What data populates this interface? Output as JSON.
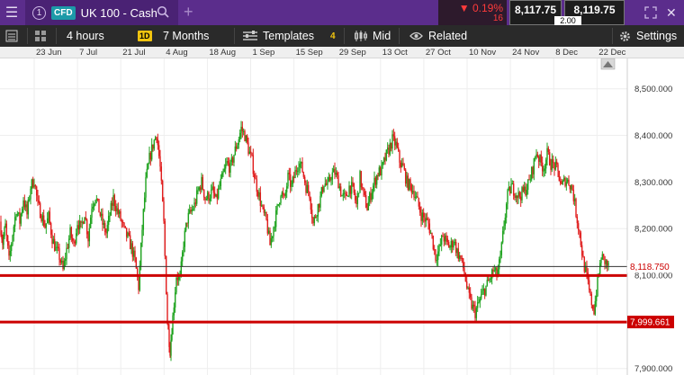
{
  "topbar": {
    "tab_number": "1",
    "instrument_type": "CFD",
    "instrument_name": "UK 100 - Cash",
    "change_percent": "▼ 0.19%",
    "change_points": "16",
    "sell_price": "8,117.75",
    "buy_price": "8,119.75",
    "spread": "2.00"
  },
  "toolbar": {
    "interval": "4 hours",
    "candle_badge": "1D",
    "range": "7 Months",
    "templates_label": "Templates",
    "templates_count": "4",
    "price_type": "Mid",
    "related_label": "Related",
    "settings_label": "Settings"
  },
  "colors": {
    "up": "#1fa31f",
    "down": "#e01d1d",
    "line": "#cc0000",
    "accent": "#5b2d8c"
  },
  "chart_data": {
    "type": "candlestick",
    "x_labels": [
      "23 Jun",
      "7 Jul",
      "21 Jul",
      "4 Aug",
      "18 Aug",
      "1 Sep",
      "15 Sep",
      "29 Sep",
      "13 Oct",
      "27 Oct",
      "10 Nov",
      "24 Nov",
      "8 Dec",
      "22 Dec"
    ],
    "y_ticks": [
      7900,
      8000,
      8100,
      8200,
      8300,
      8400,
      8500
    ],
    "y_tick_labels": [
      "7,900.000",
      "8,000.000",
      "8,100.000",
      "8,200.000",
      "8,300.000",
      "8,400.000",
      "8,500.000"
    ],
    "ylim": [
      7886,
      8565
    ],
    "current_price": 8118.75,
    "current_price_label": "8,118.750",
    "horizontal_lines": [
      {
        "value": 8099.5,
        "label": ""
      },
      {
        "value": 7999.661,
        "label": "7,999.661"
      }
    ],
    "series_path": [
      [
        0,
        8215
      ],
      [
        3,
        8170
      ],
      [
        6,
        8205
      ],
      [
        10,
        8130
      ],
      [
        14,
        8190
      ],
      [
        18,
        8240
      ],
      [
        22,
        8215
      ],
      [
        26,
        8265
      ],
      [
        30,
        8230
      ],
      [
        34,
        8290
      ],
      [
        38,
        8305
      ],
      [
        42,
        8250
      ],
      [
        46,
        8230
      ],
      [
        50,
        8205
      ],
      [
        54,
        8225
      ],
      [
        58,
        8180
      ],
      [
        62,
        8155
      ],
      [
        66,
        8140
      ],
      [
        70,
        8110
      ],
      [
        74,
        8155
      ],
      [
        78,
        8190
      ],
      [
        82,
        8165
      ],
      [
        86,
        8215
      ],
      [
        90,
        8200
      ],
      [
        94,
        8235
      ],
      [
        98,
        8180
      ],
      [
        102,
        8250
      ],
      [
        106,
        8270
      ],
      [
        110,
        8240
      ],
      [
        114,
        8210
      ],
      [
        118,
        8190
      ],
      [
        122,
        8230
      ],
      [
        126,
        8265
      ],
      [
        130,
        8240
      ],
      [
        134,
        8220
      ],
      [
        138,
        8195
      ],
      [
        142,
        8180
      ],
      [
        146,
        8160
      ],
      [
        150,
        8130
      ],
      [
        154,
        8075
      ],
      [
        158,
        8200
      ],
      [
        162,
        8300
      ],
      [
        166,
        8350
      ],
      [
        170,
        8380
      ],
      [
        174,
        8405
      ],
      [
        178,
        8330
      ],
      [
        182,
        8210
      ],
      [
        186,
        8000
      ],
      [
        189,
        7940
      ],
      [
        192,
        8010
      ],
      [
        196,
        8100
      ],
      [
        200,
        8090
      ],
      [
        204,
        8170
      ],
      [
        208,
        8220
      ],
      [
        212,
        8235
      ],
      [
        216,
        8250
      ],
      [
        220,
        8280
      ],
      [
        224,
        8300
      ],
      [
        228,
        8265
      ],
      [
        232,
        8270
      ],
      [
        236,
        8280
      ],
      [
        240,
        8260
      ],
      [
        244,
        8290
      ],
      [
        248,
        8315
      ],
      [
        252,
        8340
      ],
      [
        256,
        8330
      ],
      [
        260,
        8360
      ],
      [
        264,
        8385
      ],
      [
        268,
        8415
      ],
      [
        272,
        8400
      ],
      [
        276,
        8370
      ],
      [
        280,
        8345
      ],
      [
        284,
        8300
      ],
      [
        288,
        8270
      ],
      [
        292,
        8235
      ],
      [
        296,
        8215
      ],
      [
        300,
        8165
      ],
      [
        304,
        8205
      ],
      [
        308,
        8240
      ],
      [
        312,
        8280
      ],
      [
        316,
        8260
      ],
      [
        320,
        8310
      ],
      [
        324,
        8290
      ],
      [
        328,
        8320
      ],
      [
        332,
        8345
      ],
      [
        336,
        8325
      ],
      [
        340,
        8290
      ],
      [
        344,
        8275
      ],
      [
        348,
        8210
      ],
      [
        352,
        8240
      ],
      [
        356,
        8265
      ],
      [
        360,
        8300
      ],
      [
        364,
        8290
      ],
      [
        368,
        8315
      ],
      [
        372,
        8320
      ],
      [
        376,
        8300
      ],
      [
        380,
        8270
      ],
      [
        384,
        8265
      ],
      [
        388,
        8290
      ],
      [
        392,
        8285
      ],
      [
        396,
        8250
      ],
      [
        400,
        8310
      ],
      [
        404,
        8270
      ],
      [
        408,
        8245
      ],
      [
        412,
        8275
      ],
      [
        416,
        8300
      ],
      [
        420,
        8320
      ],
      [
        424,
        8325
      ],
      [
        428,
        8350
      ],
      [
        432,
        8370
      ],
      [
        436,
        8390
      ],
      [
        440,
        8380
      ],
      [
        444,
        8345
      ],
      [
        448,
        8330
      ],
      [
        452,
        8300
      ],
      [
        456,
        8290
      ],
      [
        460,
        8280
      ],
      [
        464,
        8255
      ],
      [
        468,
        8230
      ],
      [
        472,
        8220
      ],
      [
        476,
        8210
      ],
      [
        480,
        8180
      ],
      [
        484,
        8140
      ],
      [
        488,
        8155
      ],
      [
        492,
        8185
      ],
      [
        496,
        8170
      ],
      [
        500,
        8160
      ],
      [
        504,
        8175
      ],
      [
        508,
        8150
      ],
      [
        512,
        8135
      ],
      [
        516,
        8105
      ],
      [
        520,
        8060
      ],
      [
        524,
        8035
      ],
      [
        528,
        8020
      ],
      [
        532,
        8040
      ],
      [
        536,
        8060
      ],
      [
        540,
        8075
      ],
      [
        544,
        8090
      ],
      [
        548,
        8110
      ],
      [
        552,
        8100
      ],
      [
        556,
        8135
      ],
      [
        560,
        8210
      ],
      [
        564,
        8270
      ],
      [
        568,
        8290
      ],
      [
        572,
        8280
      ],
      [
        576,
        8270
      ],
      [
        580,
        8275
      ],
      [
        584,
        8285
      ],
      [
        588,
        8300
      ],
      [
        592,
        8330
      ],
      [
        596,
        8365
      ],
      [
        600,
        8345
      ],
      [
        604,
        8330
      ],
      [
        608,
        8360
      ],
      [
        612,
        8340
      ],
      [
        616,
        8335
      ],
      [
        620,
        8320
      ],
      [
        624,
        8290
      ],
      [
        628,
        8305
      ],
      [
        632,
        8300
      ],
      [
        636,
        8285
      ],
      [
        640,
        8235
      ],
      [
        644,
        8190
      ],
      [
        648,
        8130
      ],
      [
        652,
        8095
      ],
      [
        656,
        8050
      ],
      [
        660,
        8025
      ],
      [
        664,
        8085
      ],
      [
        668,
        8140
      ],
      [
        672,
        8130
      ],
      [
        676,
        8118
      ]
    ]
  }
}
